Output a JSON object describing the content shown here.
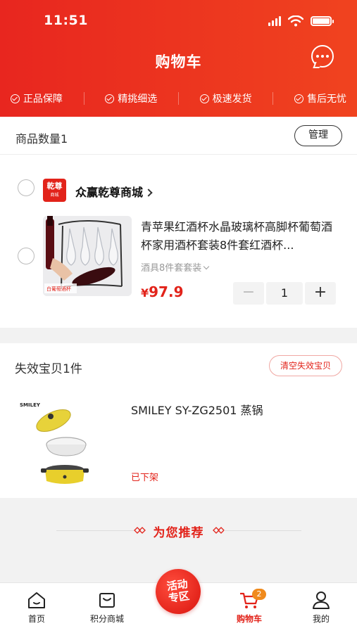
{
  "status_bar": {
    "time": "11:51"
  },
  "header": {
    "title": "购物车",
    "assurances": [
      "正品保障",
      "精挑细选",
      "极速发货",
      "售后无忧"
    ]
  },
  "cart": {
    "count_label": "商品数量1",
    "manage_label": "管理"
  },
  "store": {
    "logo_line1": "乾尊",
    "logo_line2": "商城",
    "name": "众赢乾尊商城",
    "product": {
      "title": "青苹果红酒杯水晶玻璃杯高脚杯葡萄酒杯家用酒杯套装8件套红酒杯...",
      "spec": "酒具8件套套装",
      "price_symbol": "¥",
      "price": "97.9",
      "quantity": "1",
      "minus": "−",
      "plus": "+",
      "image_caption": "白葡萄酒杯"
    }
  },
  "invalid": {
    "title": "失效宝贝1件",
    "clear_label": "清空失效宝贝",
    "item_name": "SMILEY SY-ZG2501 蒸锅",
    "item_status": "已下架",
    "image_brand": "SMILEY"
  },
  "recommend": {
    "title": "为您推荐"
  },
  "tabbar": {
    "home": "首页",
    "points_mall": "积分商城",
    "promo_line1": "活动",
    "promo_line2": "专区",
    "cart": "购物车",
    "cart_badge": "2",
    "mine": "我的"
  },
  "colors": {
    "brand_red": "#e2231a",
    "header_gradient_end": "#f0431f",
    "badge_orange": "#f08a1c"
  }
}
